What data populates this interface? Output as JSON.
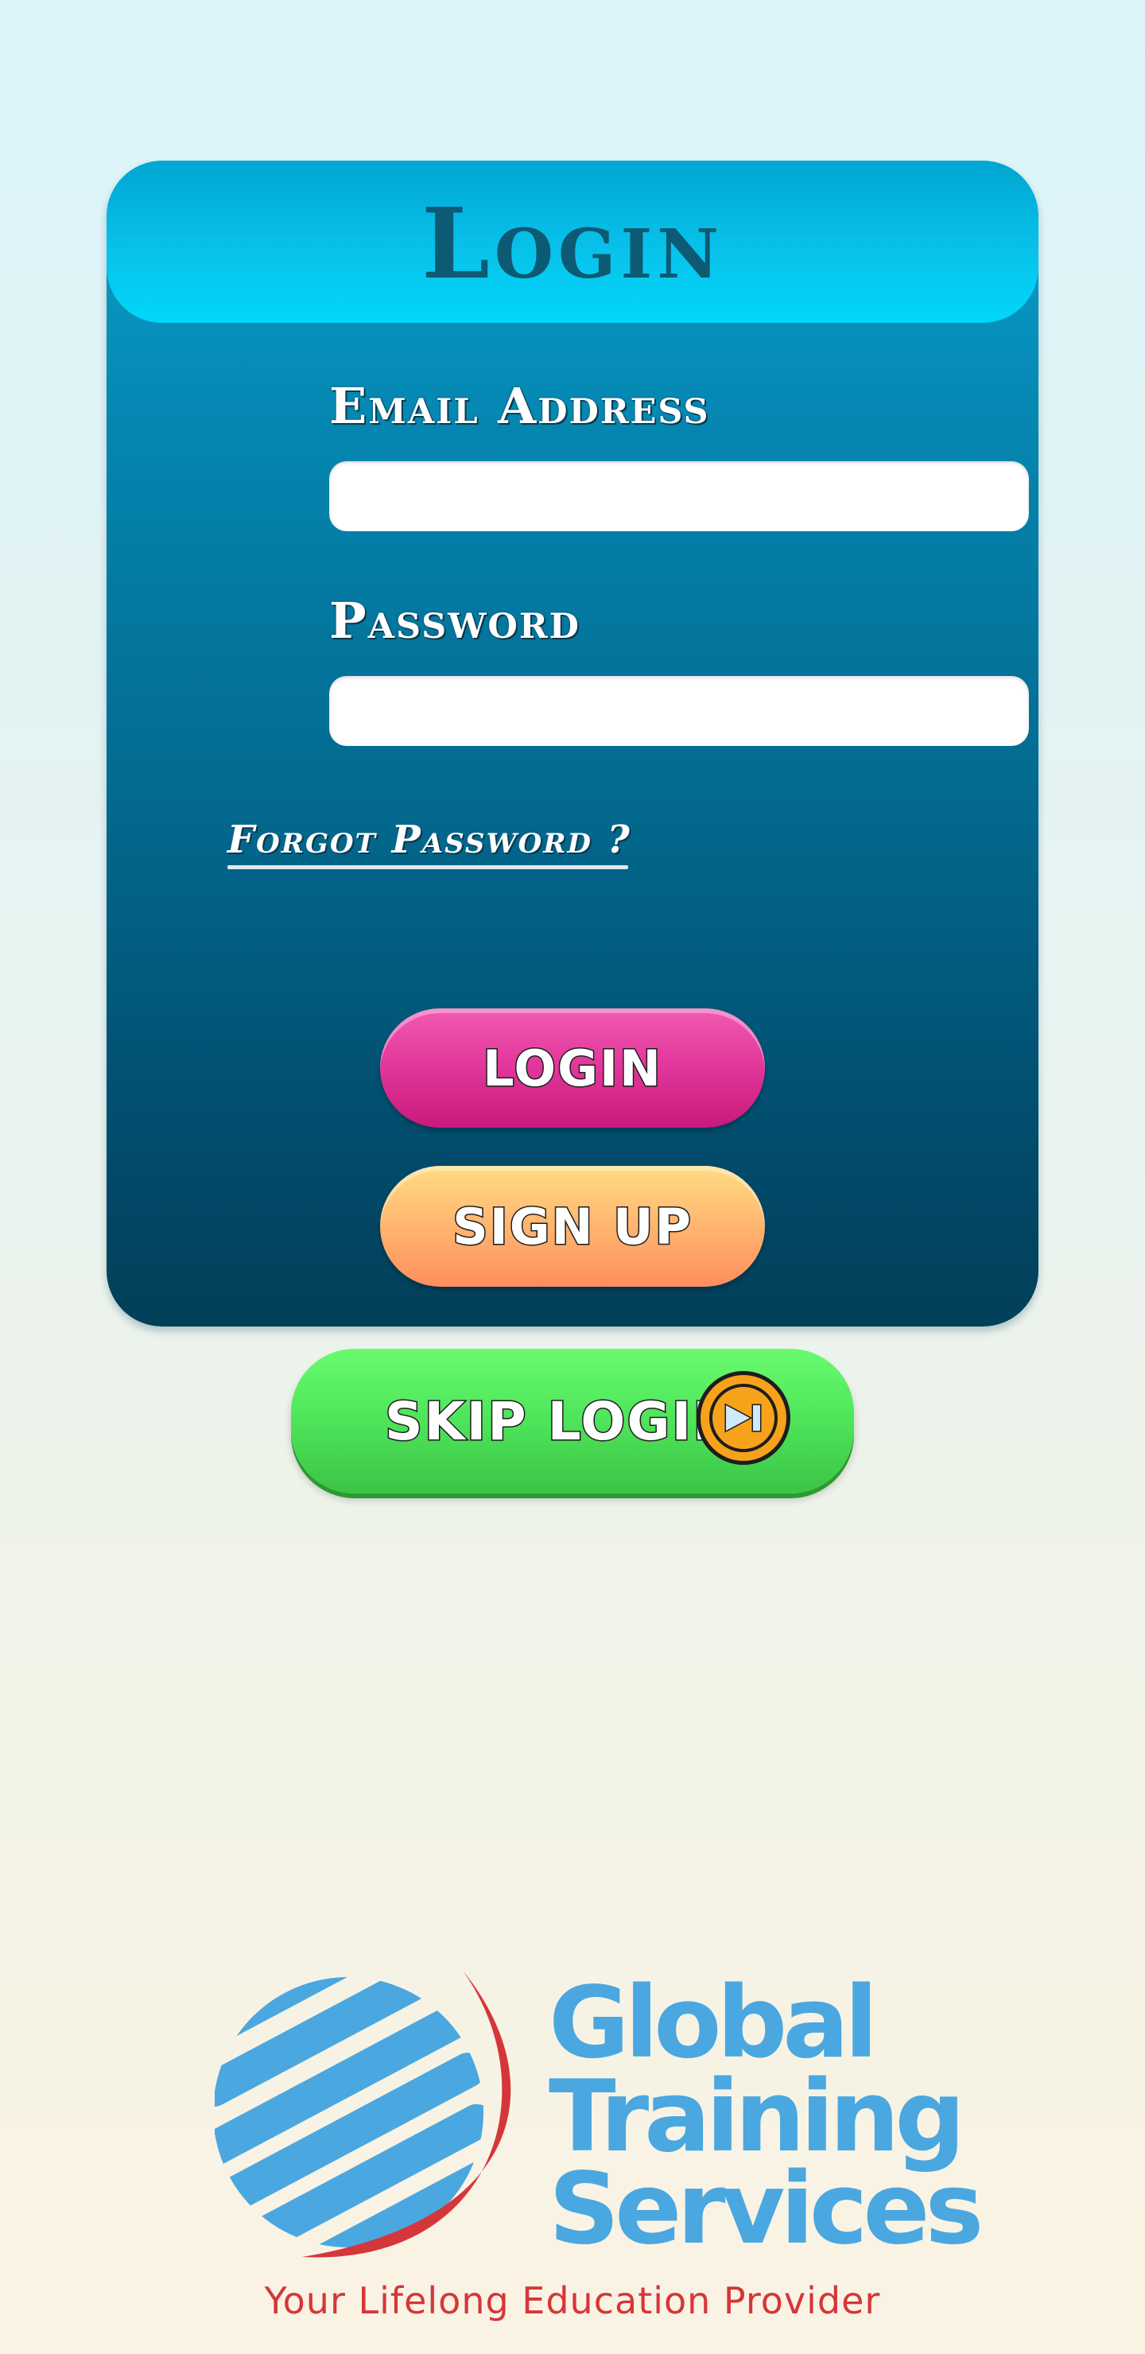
{
  "login_card": {
    "title": "Login",
    "email_label": "Email Address",
    "email_value": "",
    "password_label": "Password",
    "password_value": "",
    "forgot_password": "Forgot Password ?"
  },
  "buttons": {
    "login": "LOGIN",
    "sign_up": "SIGN UP",
    "skip_login": "SKIP LOGIN",
    "skip_icon": "skip-next-icon"
  },
  "logo": {
    "line1": "Global",
    "line2": "Training",
    "line3": "Services",
    "tagline": "Your Lifelong Education Provider"
  },
  "colors": {
    "card_top": "#0aa2cc",
    "card_bottom": "#033f58",
    "login_button": "#e3399c",
    "signup_button": "#ffb56f",
    "skip_button": "#4ee45a",
    "logo_blue": "#4aa7e0",
    "logo_red": "#d5363a"
  }
}
